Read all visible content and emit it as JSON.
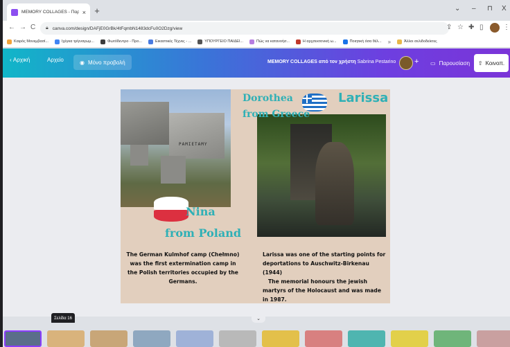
{
  "browser": {
    "tab_title": "MEMORY COLLAGES - Παρουσίασ...",
    "tab_close": "×",
    "new_tab": "+",
    "window_controls": {
      "menu": "⌄",
      "minimize": "–",
      "restore": "⊓",
      "close": "X"
    },
    "nav": {
      "back": "←",
      "forward": "→",
      "reload": "C"
    },
    "url": "canva.com/design/DAFjE0GrBk/4tFqmbN1483dcFu0O2Dzg/view",
    "bookmarks": [
      {
        "label": "Καιρός Μονεμβασί...",
        "color": "#f2a33a"
      },
      {
        "label": "Ιχέγκα τρίγναγωμ...",
        "color": "#4285f4"
      },
      {
        "label": "Φωτόδεντρο - Προ...",
        "color": "#3c3c3c"
      },
      {
        "label": "Εικαστικές Τέχνες - ...",
        "color": "#4a7be0"
      },
      {
        "label": "ΥΠΟΥΡΓΕΙΟ ΠΑΙΔΕΙ...",
        "color": "#555555"
      },
      {
        "label": "Πώς να κατανοήσ...",
        "color": "#b77ee0"
      },
      {
        "label": "Η αρχιτεκτονική ω...",
        "color": "#c0392b"
      },
      {
        "label": "Ποιητική όσα θέλ...",
        "color": "#1a73e8"
      }
    ],
    "bookmarks_more": "»",
    "other_bookmarks": "Άλλοι σελιδοδείκτες"
  },
  "canva_header": {
    "home": "Αρχική",
    "file": "Αρχείο",
    "view_only": "Μόνο προβολή",
    "design_title": "MEMORY COLLAGES από τον χρήστη",
    "author": "Sabrina Pestarino",
    "add": "+",
    "present": "Παρουσίαση",
    "share": "Κοινοπ."
  },
  "slide": {
    "monument_inscription": "PAMIETAMY",
    "label_dorothea": "Dorothea from Greece",
    "label_larissa": "Larissa",
    "label_nina": "Nina",
    "label_from_poland": "from Poland",
    "caption_left": "The German Kulmhof camp (Chełmno) was the first extermination camp in the Polish territories occupied by the Germans.",
    "caption_right_1": "Larissa was one of the starting points for deportations to Auschwitz-Birkenau (1944)",
    "caption_right_2": "The memorial honours the jewish martyrs of the Holocaust and was made in 1987."
  },
  "filmstrip": {
    "tooltip": "Σελίδα 16",
    "collapse": "⌄",
    "thumbs": [
      {
        "color": "#5a6e8a",
        "selected": true
      },
      {
        "color": "#d9b37c",
        "selected": false
      },
      {
        "color": "#c8a678",
        "selected": false
      },
      {
        "color": "#8fa8c0",
        "selected": false
      },
      {
        "color": "#9fb2d8",
        "selected": false
      },
      {
        "color": "#b9b9b9",
        "selected": false
      },
      {
        "color": "#e3c04a",
        "selected": false
      },
      {
        "color": "#d88080",
        "selected": false
      },
      {
        "color": "#4fb5b0",
        "selected": false
      },
      {
        "color": "#e2d04a",
        "selected": false
      },
      {
        "color": "#6fb57a",
        "selected": false
      },
      {
        "color": "#c9a0a0",
        "selected": false
      }
    ]
  },
  "colors": {
    "header_gradient_start": "#11b6c8",
    "header_gradient_end": "#7b34d8",
    "slide_background": "#e2cfbe",
    "accent_text": "#2fb0b6",
    "selection": "#8b3dff"
  }
}
